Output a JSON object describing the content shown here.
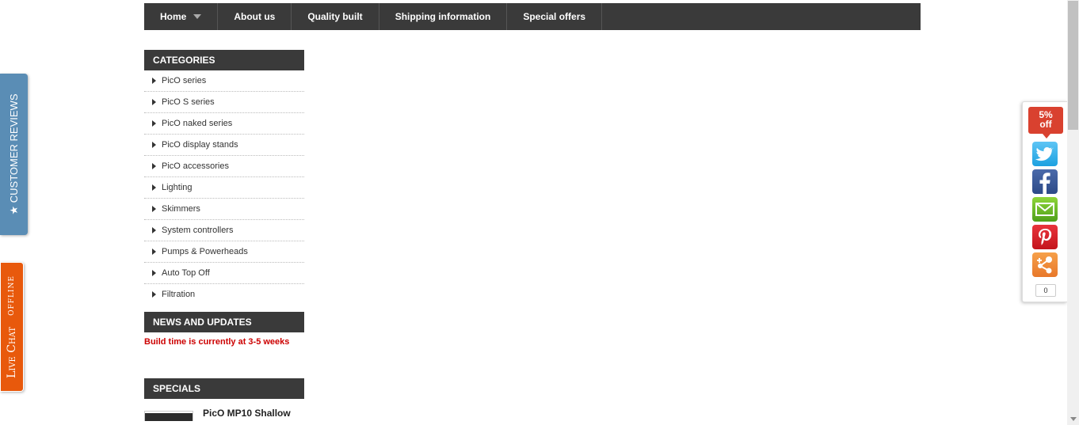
{
  "nav": {
    "items": [
      {
        "label": "Home"
      },
      {
        "label": "About us"
      },
      {
        "label": "Quality built"
      },
      {
        "label": "Shipping information"
      },
      {
        "label": "Special offers"
      }
    ]
  },
  "sidebar": {
    "categories_title": "CATEGORIES",
    "categories": [
      "PicO series",
      "PicO S series",
      "PicO naked series",
      "PicO display stands",
      "PicO accessories",
      "Lighting",
      "Skimmers",
      "System controllers",
      "Pumps & Powerheads",
      "Auto Top Off",
      "Filtration"
    ],
    "news_title": "NEWS AND UPDATES",
    "news_text": "Build time is currently at 3-5 weeks",
    "specials_title": "SPECIALS",
    "special_item_name": "PicO MP10 Shallow"
  },
  "left_tabs": {
    "reviews": "★ CUSTOMER REVIEWS",
    "chat_main": "Live Chat",
    "chat_status": "OFFLINE"
  },
  "share_bar": {
    "discount_line1": "5%",
    "discount_line2": "off",
    "count": "0",
    "colors": {
      "twitter": "#1da1e0",
      "facebook": "#3b5998",
      "email": "#6bbf2a",
      "pinterest": "#d9202a",
      "share": "#f08a3a",
      "discount": "#d9412f"
    }
  }
}
